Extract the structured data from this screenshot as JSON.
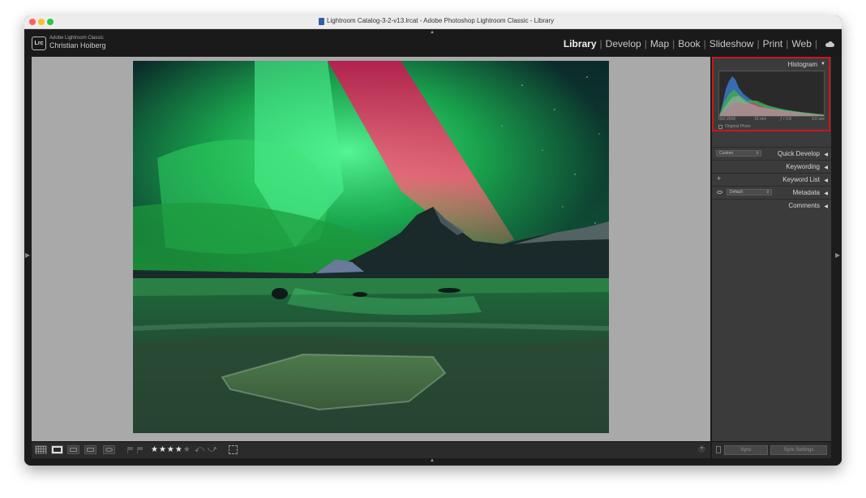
{
  "window": {
    "title": "Lightroom Catalog-3-2-v13.lrcat - Adobe Photoshop Lightroom Classic - Library"
  },
  "identity": {
    "logo": "Lrc",
    "app_name": "Adobe Lightroom Classic",
    "user_name": "Christian Hoiberg"
  },
  "modules": [
    {
      "label": "Library",
      "active": true
    },
    {
      "label": "Develop",
      "active": false
    },
    {
      "label": "Map",
      "active": false
    },
    {
      "label": "Book",
      "active": false
    },
    {
      "label": "Slideshow",
      "active": false
    },
    {
      "label": "Print",
      "active": false
    },
    {
      "label": "Web",
      "active": false
    }
  ],
  "modules_separator": "|",
  "icons": {
    "cloud": "cloud-sync-icon",
    "panel_collapse": "triangle-left-icon",
    "panel_expand": "triangle-down-icon"
  },
  "photo": {
    "subject": "Aurora borealis over mountain with frozen lake"
  },
  "toolbar": {
    "rating_stars": "★★★★",
    "rating_empty": "★",
    "rating_value": 4,
    "rating_max": 5,
    "rotate_left": "⤺",
    "rotate_right": "⤻"
  },
  "right_panel": {
    "histogram": {
      "title": "Histogram",
      "toggle": "▼",
      "iso": "ISO 2500",
      "focal_length": "15 mm",
      "aperture": "ƒ / 2.8",
      "shutter": "3.0 sec",
      "original_photo_label": "Original Photo"
    },
    "quick_develop": {
      "title": "Quick Develop",
      "preset": "Custom"
    },
    "keywording": {
      "title": "Keywording"
    },
    "keyword_list": {
      "title": "Keyword List",
      "add": "+"
    },
    "metadata": {
      "title": "Metadata",
      "preset": "Default"
    },
    "comments": {
      "title": "Comments"
    },
    "collapse_glyph": "◀"
  },
  "sync": {
    "sync_label": "Sync",
    "sync_settings_label": "Sync Settings"
  },
  "edge_arrows": {
    "up": "▲",
    "down": "▲",
    "left": "▶",
    "right": "▶"
  },
  "colors": {
    "highlight_border": "#d0141c",
    "panel_bg": "#3b3b3b",
    "canvas_bg": "#a9a9a9"
  }
}
